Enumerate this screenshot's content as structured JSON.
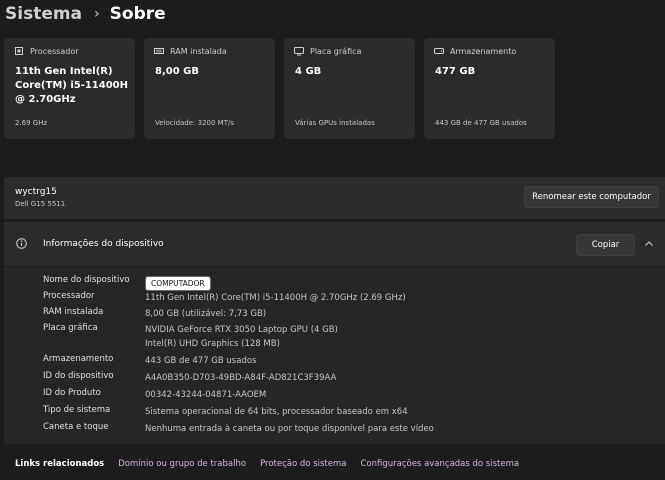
{
  "breadcrumb": {
    "parent": "Sistema",
    "separator": "›",
    "current": "Sobre"
  },
  "cards": [
    {
      "icon": "processor-icon",
      "title": "Processador",
      "value": "11th Gen Intel(R) Core(TM) i5-11400H @ 2.70GHz",
      "sub": "2.69 GHz"
    },
    {
      "icon": "ram-icon",
      "title": "RAM instalada",
      "value": "8,00 GB",
      "sub": "Velocidade: 3200 MT/s"
    },
    {
      "icon": "gpu-icon",
      "title": "Placa gráfica",
      "value": "4 GB",
      "sub": "Várias GPUs instaladas"
    },
    {
      "icon": "storage-icon",
      "title": "Armazenamento",
      "value": "477 GB",
      "sub": "443 GB de 477 GB usados"
    }
  ],
  "device": {
    "name": "wyctrg15",
    "model": "Dell G15 5511",
    "rename_label": "Renomear este computador"
  },
  "specs": {
    "title": "Informações do dispositivo",
    "copy_label": "Copiar",
    "rows": [
      {
        "label": "Nome do dispositivo",
        "value": "COMPUTADOR"
      },
      {
        "label": "Processador",
        "value": "11th Gen Intel(R) Core(TM) i5-11400H @ 2.70GHz (2.69 GHz)"
      },
      {
        "label": "RAM instalada",
        "value": "8,00 GB (utilizável: 7,73 GB)"
      },
      {
        "label": "Placa gráfica",
        "value": "NVIDIA GeForce RTX 3050 Laptop GPU (4 GB)",
        "value2": "Intel(R) UHD Graphics (128 MB)"
      },
      {
        "label": "Armazenamento",
        "value": "443 GB de 477 GB usados"
      },
      {
        "label": "ID do dispositivo",
        "value": "A4A0B350-D703-49BD-A84F-AD821C3F39AA"
      },
      {
        "label": "ID do Produto",
        "value": "00342-43244-04871-AAOEM"
      },
      {
        "label": "Tipo de sistema",
        "value": "Sistema operacional de 64 bits, processador baseado em x64"
      },
      {
        "label": "Caneta e toque",
        "value": "Nenhuma entrada à caneta ou por toque disponível para este vídeo"
      }
    ]
  },
  "related": {
    "title": "Links relacionados",
    "links": [
      "Domínio ou grupo de trabalho",
      "Proteção do sistema",
      "Configurações avançadas do sistema"
    ]
  }
}
